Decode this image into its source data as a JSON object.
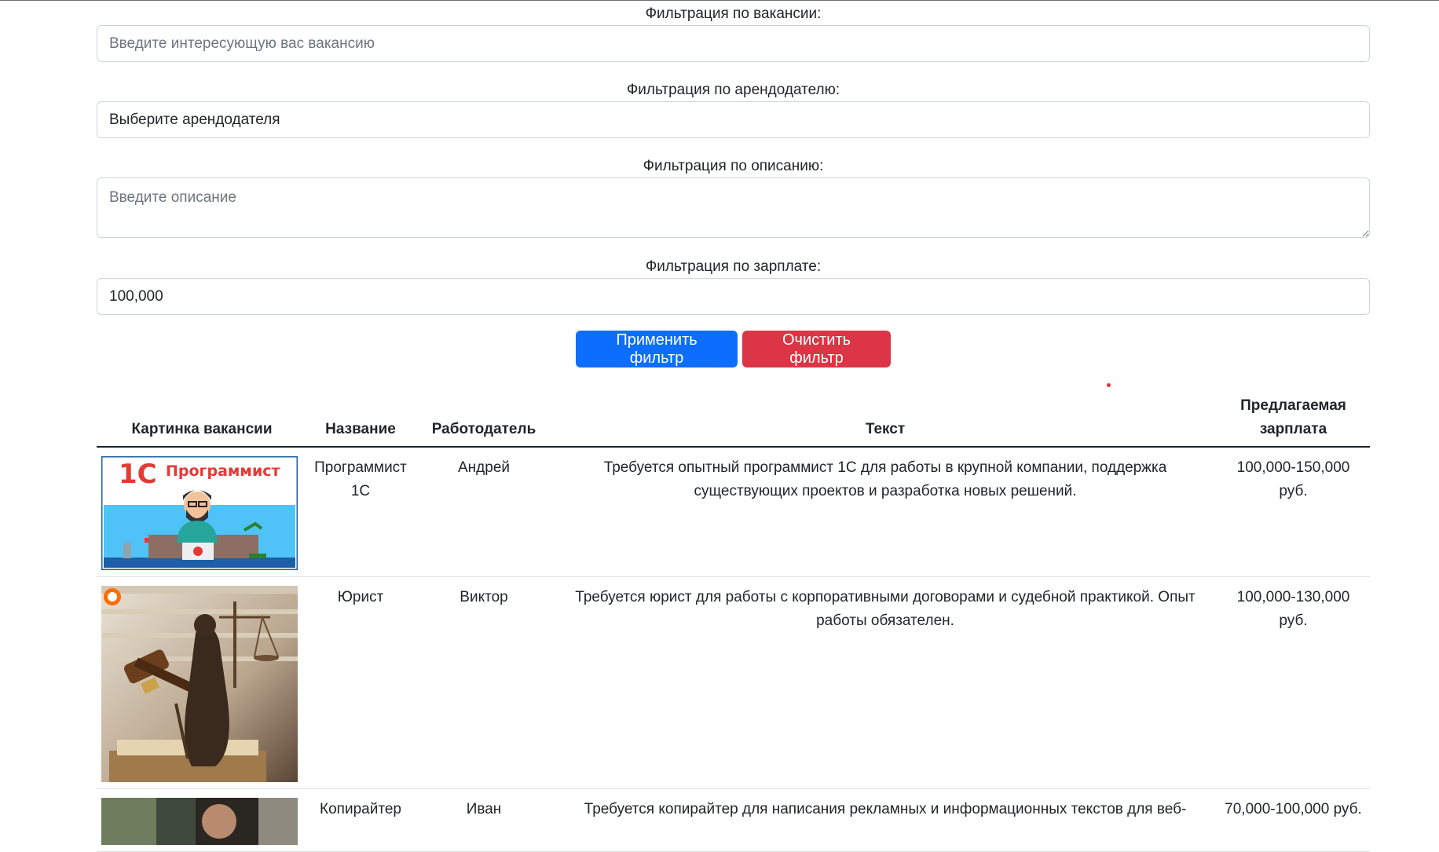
{
  "filters": {
    "vacancy_label": "Фильтрация по вакансии:",
    "vacancy_placeholder": "Введите интересующую вас вакансию",
    "employer_label": "Фильтрация по арендодателю:",
    "employer_selected": "Выберите арендодателя",
    "description_label": "Фильтрация по описанию:",
    "description_placeholder": "Введите описание",
    "salary_label": "Фильтрация по зарплате:",
    "salary_value": "100,000",
    "apply_label": "Применить фильтр",
    "clear_label": "Очистить фильтр"
  },
  "table": {
    "headers": [
      "Картинка вакансии",
      "Название",
      "Работодатель",
      "Текст",
      "Предлагаемая зарплата"
    ],
    "rows": [
      {
        "image": "1c-programmer-image",
        "image_text": "1С Программист",
        "title": "Программист 1С",
        "employer": "Андрей",
        "text": "Требуется опытный программист 1С для работы в крупной компании, поддержка существующих проектов и разработка новых решений.",
        "salary": "100,000-150,000 руб."
      },
      {
        "image": "lawyer-themis-image",
        "title": "Юрист",
        "employer": "Виктор",
        "text": "Требуется юрист для работы с корпоративными договорами и судебной практикой. Опыт работы обязателен.",
        "salary": "100,000-130,000 руб."
      },
      {
        "image": "copywriter-image",
        "title": "Копирайтер",
        "employer": "Иван",
        "text": "Требуется копирайтер для написания рекламных и информационных текстов для веб-",
        "salary": "70,000-100,000 руб."
      }
    ]
  },
  "colors": {
    "primary": "#0d6efd",
    "danger": "#dc3545",
    "text": "#212529",
    "placeholder": "#6c757d",
    "border": "#ced4da"
  }
}
